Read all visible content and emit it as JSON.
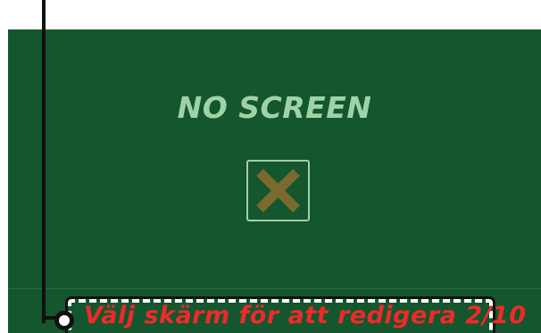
{
  "screen": {
    "title": "NO SCREEN",
    "icon": "close-x-icon"
  },
  "annotation": {
    "label": "Välj skärm för att redigera 2/10"
  },
  "colors": {
    "screen_bg": "#14562e",
    "title_text": "#9fd3a6",
    "icon_border": "#a5cfa9",
    "icon_x": "#7a6a2e",
    "annotation_text": "#ee2a2a"
  }
}
